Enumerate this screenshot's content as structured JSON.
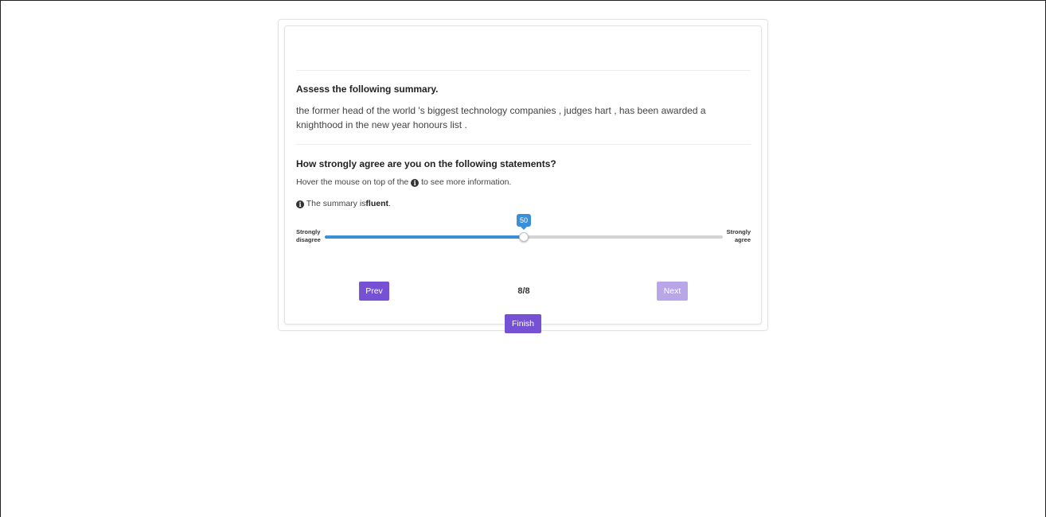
{
  "task": {
    "assess_heading": "Assess the following summary.",
    "summary": "the former head of the world 's biggest technology companies , judges hart , has been awarded a knighthood in the new year honours list ."
  },
  "questions": {
    "heading": "How strongly agree are you on the following statements?",
    "hint_before": "Hover the mouse on top of the",
    "hint_after": "to see more information.",
    "info_icon": "info-circle-icon",
    "statement_prefix": "The summary is",
    "statement_keyword": "fluent",
    "statement_suffix": "."
  },
  "slider": {
    "min_label": "Strongly disagree",
    "max_label": "Strongly agree",
    "min": 0,
    "max": 100,
    "value": 50,
    "value_label": "50",
    "fill_color": "#3b8fd6",
    "track_color": "#d3d3d3"
  },
  "navigation": {
    "prev_label": "Prev",
    "next_label": "Next",
    "page_indicator": "8/8",
    "finish_label": "Finish",
    "next_disabled": true,
    "button_color": "#7751d4",
    "disabled_button_color": "#b9a6e8"
  }
}
